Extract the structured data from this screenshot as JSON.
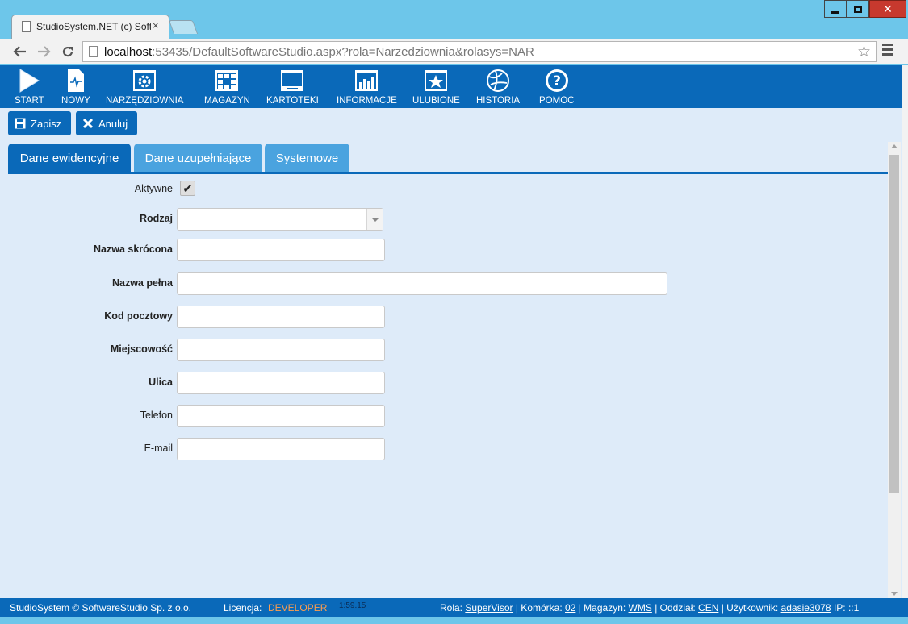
{
  "browser": {
    "tab_title": "StudioSystem.NET (c) Soft",
    "tab_close": "×",
    "url_host": "localhost",
    "url_rest": ":53435/DefaultSoftwareStudio.aspx?rola=Narzedziownia&rolasys=NAR"
  },
  "menu": {
    "items": [
      {
        "label": "START",
        "icon": "play-icon"
      },
      {
        "label": "NOWY",
        "icon": "new-document-icon"
      },
      {
        "label": "NARZĘDZIOWNIA",
        "icon": "gear-window-icon"
      },
      {
        "label": "MAGAZYN",
        "icon": "grid-window-icon"
      },
      {
        "label": "KARTOTEKI",
        "icon": "monitor-icon"
      },
      {
        "label": "INFORMACJE",
        "icon": "bar-chart-icon"
      },
      {
        "label": "ULUBIONE",
        "icon": "star-window-icon"
      },
      {
        "label": "HISTORIA",
        "icon": "globe-icon"
      },
      {
        "label": "POMOC",
        "icon": "help-icon"
      }
    ]
  },
  "actions": {
    "save": "Zapisz",
    "cancel": "Anuluj"
  },
  "tabs": [
    {
      "label": "Dane ewidencyjne",
      "active": true
    },
    {
      "label": "Dane uzupełniające",
      "active": false
    },
    {
      "label": "Systemowe",
      "active": false
    }
  ],
  "form": {
    "aktywne": {
      "label": "Aktywne",
      "checked": true
    },
    "rodzaj": {
      "label": "Rodzaj",
      "value": ""
    },
    "nazwa_skrocona": {
      "label": "Nazwa skrócona",
      "value": ""
    },
    "nazwa_pelna": {
      "label": "Nazwa pełna",
      "value": ""
    },
    "kod_pocztowy": {
      "label": "Kod pocztowy",
      "value": ""
    },
    "miejscowosc": {
      "label": "Miejscowość",
      "value": ""
    },
    "ulica": {
      "label": "Ulica",
      "value": ""
    },
    "telefon": {
      "label": "Telefon",
      "value": ""
    },
    "email": {
      "label": "E-mail",
      "value": ""
    }
  },
  "status": {
    "copyright": "StudioSystem © SoftwareStudio Sp. z o.o.",
    "licencja_label": "Licencja:",
    "licencja_value": "DEVELOPER",
    "time": "1:59.15",
    "rola_label": "Rola:",
    "rola_value": "SuperVisor",
    "komorka_label": "| Komórka:",
    "komorka_value": "02",
    "magazyn_label": "| Magazyn:",
    "magazyn_value": "WMS",
    "oddzial_label": "| Oddział:",
    "oddzial_value": "CEN",
    "uzytkownik_label": "| Użytkownik:",
    "uzytkownik_value": "adasie3078",
    "ip_label": "IP:",
    "ip_value": "::1"
  },
  "colors": {
    "primary": "#0a69b9",
    "tab_inactive": "#4aa3df",
    "content_bg": "#deebf9",
    "license": "#ff9d4d"
  }
}
